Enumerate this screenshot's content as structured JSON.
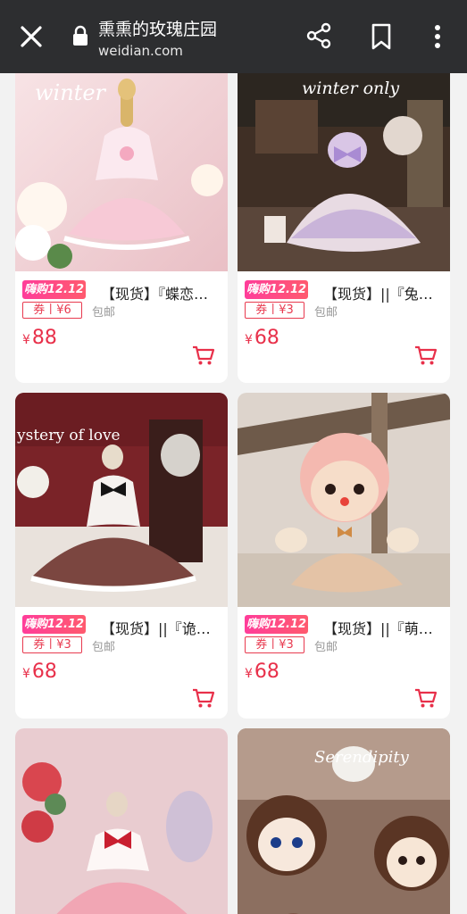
{
  "header": {
    "title": "熏熏的玫瑰庄园",
    "url": "weidian.com",
    "icons": [
      "close-icon",
      "lock-icon",
      "share-icon",
      "bookmark-icon",
      "more-icon"
    ]
  },
  "colors": {
    "topbar": "#2d2e30",
    "price": "#e8304a",
    "promo": "#ff3d9a"
  },
  "products": [
    {
      "promo": "嗨购12.12",
      "name": "【现货】『蝶恋…",
      "coupon": "券丨¥6",
      "shipping": "包邮",
      "currency": "¥",
      "price": "88",
      "image_text": "winter"
    },
    {
      "promo": "嗨购12.12",
      "name": "【现货】||『兔…",
      "coupon": "券丨¥3",
      "shipping": "包邮",
      "currency": "¥",
      "price": "68",
      "image_text": "winter only"
    },
    {
      "promo": "嗨购12.12",
      "name": "【现货】||『诡…",
      "coupon": "券丨¥3",
      "shipping": "包邮",
      "currency": "¥",
      "price": "68",
      "image_text": "ystery of love"
    },
    {
      "promo": "嗨购12.12",
      "name": "【现货】||『萌…",
      "coupon": "券丨¥3",
      "shipping": "包邮",
      "currency": "¥",
      "price": "68",
      "image_text": ""
    },
    {
      "promo": "",
      "name": "",
      "coupon": "",
      "shipping": "",
      "currency": "",
      "price": "",
      "image_text": ""
    },
    {
      "promo": "",
      "name": "",
      "coupon": "",
      "shipping": "",
      "currency": "",
      "price": "",
      "image_text": "Serendipity"
    }
  ]
}
